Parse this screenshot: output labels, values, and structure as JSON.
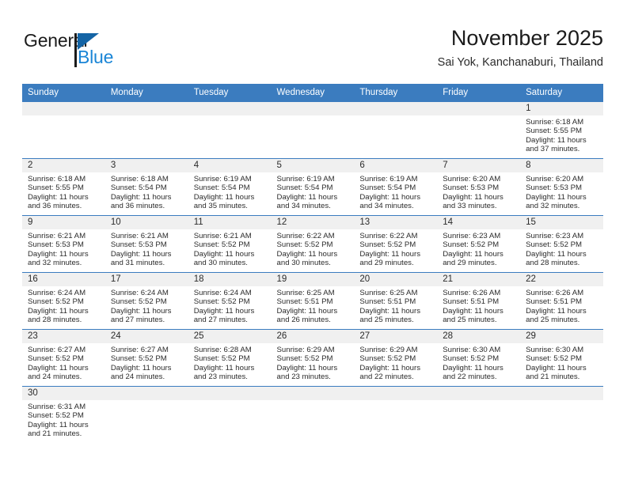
{
  "brand": {
    "name_part1": "General",
    "name_part2": "Blue",
    "accent_color": "#1a85d6",
    "triangle_color": "#1464a5"
  },
  "header": {
    "title": "November 2025",
    "subtitle": "Sai Yok, Kanchanaburi, Thailand"
  },
  "calendar": {
    "header_bg": "#3b7cbf",
    "daynum_bg": "#f0f0f0",
    "weekdays": [
      "Sunday",
      "Monday",
      "Tuesday",
      "Wednesday",
      "Thursday",
      "Friday",
      "Saturday"
    ],
    "weeks": [
      [
        {
          "day": "",
          "lines": []
        },
        {
          "day": "",
          "lines": []
        },
        {
          "day": "",
          "lines": []
        },
        {
          "day": "",
          "lines": []
        },
        {
          "day": "",
          "lines": []
        },
        {
          "day": "",
          "lines": []
        },
        {
          "day": "1",
          "lines": [
            "Sunrise: 6:18 AM",
            "Sunset: 5:55 PM",
            "Daylight: 11 hours",
            "and 37 minutes."
          ]
        }
      ],
      [
        {
          "day": "2",
          "lines": [
            "Sunrise: 6:18 AM",
            "Sunset: 5:55 PM",
            "Daylight: 11 hours",
            "and 36 minutes."
          ]
        },
        {
          "day": "3",
          "lines": [
            "Sunrise: 6:18 AM",
            "Sunset: 5:54 PM",
            "Daylight: 11 hours",
            "and 36 minutes."
          ]
        },
        {
          "day": "4",
          "lines": [
            "Sunrise: 6:19 AM",
            "Sunset: 5:54 PM",
            "Daylight: 11 hours",
            "and 35 minutes."
          ]
        },
        {
          "day": "5",
          "lines": [
            "Sunrise: 6:19 AM",
            "Sunset: 5:54 PM",
            "Daylight: 11 hours",
            "and 34 minutes."
          ]
        },
        {
          "day": "6",
          "lines": [
            "Sunrise: 6:19 AM",
            "Sunset: 5:54 PM",
            "Daylight: 11 hours",
            "and 34 minutes."
          ]
        },
        {
          "day": "7",
          "lines": [
            "Sunrise: 6:20 AM",
            "Sunset: 5:53 PM",
            "Daylight: 11 hours",
            "and 33 minutes."
          ]
        },
        {
          "day": "8",
          "lines": [
            "Sunrise: 6:20 AM",
            "Sunset: 5:53 PM",
            "Daylight: 11 hours",
            "and 32 minutes."
          ]
        }
      ],
      [
        {
          "day": "9",
          "lines": [
            "Sunrise: 6:21 AM",
            "Sunset: 5:53 PM",
            "Daylight: 11 hours",
            "and 32 minutes."
          ]
        },
        {
          "day": "10",
          "lines": [
            "Sunrise: 6:21 AM",
            "Sunset: 5:53 PM",
            "Daylight: 11 hours",
            "and 31 minutes."
          ]
        },
        {
          "day": "11",
          "lines": [
            "Sunrise: 6:21 AM",
            "Sunset: 5:52 PM",
            "Daylight: 11 hours",
            "and 30 minutes."
          ]
        },
        {
          "day": "12",
          "lines": [
            "Sunrise: 6:22 AM",
            "Sunset: 5:52 PM",
            "Daylight: 11 hours",
            "and 30 minutes."
          ]
        },
        {
          "day": "13",
          "lines": [
            "Sunrise: 6:22 AM",
            "Sunset: 5:52 PM",
            "Daylight: 11 hours",
            "and 29 minutes."
          ]
        },
        {
          "day": "14",
          "lines": [
            "Sunrise: 6:23 AM",
            "Sunset: 5:52 PM",
            "Daylight: 11 hours",
            "and 29 minutes."
          ]
        },
        {
          "day": "15",
          "lines": [
            "Sunrise: 6:23 AM",
            "Sunset: 5:52 PM",
            "Daylight: 11 hours",
            "and 28 minutes."
          ]
        }
      ],
      [
        {
          "day": "16",
          "lines": [
            "Sunrise: 6:24 AM",
            "Sunset: 5:52 PM",
            "Daylight: 11 hours",
            "and 28 minutes."
          ]
        },
        {
          "day": "17",
          "lines": [
            "Sunrise: 6:24 AM",
            "Sunset: 5:52 PM",
            "Daylight: 11 hours",
            "and 27 minutes."
          ]
        },
        {
          "day": "18",
          "lines": [
            "Sunrise: 6:24 AM",
            "Sunset: 5:52 PM",
            "Daylight: 11 hours",
            "and 27 minutes."
          ]
        },
        {
          "day": "19",
          "lines": [
            "Sunrise: 6:25 AM",
            "Sunset: 5:51 PM",
            "Daylight: 11 hours",
            "and 26 minutes."
          ]
        },
        {
          "day": "20",
          "lines": [
            "Sunrise: 6:25 AM",
            "Sunset: 5:51 PM",
            "Daylight: 11 hours",
            "and 25 minutes."
          ]
        },
        {
          "day": "21",
          "lines": [
            "Sunrise: 6:26 AM",
            "Sunset: 5:51 PM",
            "Daylight: 11 hours",
            "and 25 minutes."
          ]
        },
        {
          "day": "22",
          "lines": [
            "Sunrise: 6:26 AM",
            "Sunset: 5:51 PM",
            "Daylight: 11 hours",
            "and 25 minutes."
          ]
        }
      ],
      [
        {
          "day": "23",
          "lines": [
            "Sunrise: 6:27 AM",
            "Sunset: 5:52 PM",
            "Daylight: 11 hours",
            "and 24 minutes."
          ]
        },
        {
          "day": "24",
          "lines": [
            "Sunrise: 6:27 AM",
            "Sunset: 5:52 PM",
            "Daylight: 11 hours",
            "and 24 minutes."
          ]
        },
        {
          "day": "25",
          "lines": [
            "Sunrise: 6:28 AM",
            "Sunset: 5:52 PM",
            "Daylight: 11 hours",
            "and 23 minutes."
          ]
        },
        {
          "day": "26",
          "lines": [
            "Sunrise: 6:29 AM",
            "Sunset: 5:52 PM",
            "Daylight: 11 hours",
            "and 23 minutes."
          ]
        },
        {
          "day": "27",
          "lines": [
            "Sunrise: 6:29 AM",
            "Sunset: 5:52 PM",
            "Daylight: 11 hours",
            "and 22 minutes."
          ]
        },
        {
          "day": "28",
          "lines": [
            "Sunrise: 6:30 AM",
            "Sunset: 5:52 PM",
            "Daylight: 11 hours",
            "and 22 minutes."
          ]
        },
        {
          "day": "29",
          "lines": [
            "Sunrise: 6:30 AM",
            "Sunset: 5:52 PM",
            "Daylight: 11 hours",
            "and 21 minutes."
          ]
        }
      ],
      [
        {
          "day": "30",
          "lines": [
            "Sunrise: 6:31 AM",
            "Sunset: 5:52 PM",
            "Daylight: 11 hours",
            "and 21 minutes."
          ]
        },
        {
          "day": "",
          "lines": []
        },
        {
          "day": "",
          "lines": []
        },
        {
          "day": "",
          "lines": []
        },
        {
          "day": "",
          "lines": []
        },
        {
          "day": "",
          "lines": []
        },
        {
          "day": "",
          "lines": []
        }
      ]
    ]
  }
}
